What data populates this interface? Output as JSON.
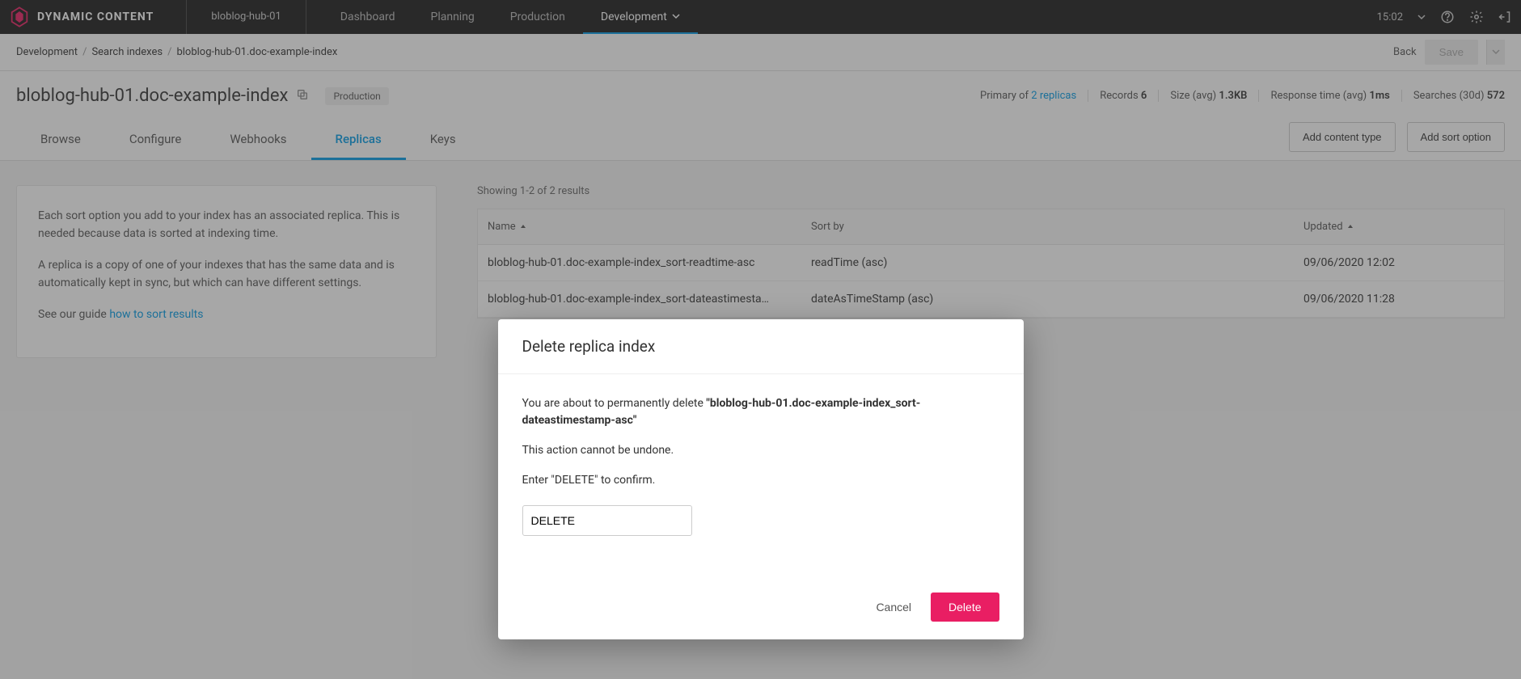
{
  "brand": "DYNAMIC CONTENT",
  "hub": "bloblog-hub-01",
  "top_tabs": {
    "dashboard": "Dashboard",
    "planning": "Planning",
    "production": "Production",
    "development": "Development"
  },
  "time": "15:02",
  "breadcrumbs": {
    "a": "Development",
    "b": "Search indexes",
    "c": "bloblog-hub-01.doc-example-index"
  },
  "back": "Back",
  "save": "Save",
  "page_title": "bloblog-hub-01.doc-example-index",
  "badge": "Production",
  "stats": {
    "primary_label": "Primary of ",
    "primary_link": "2 replicas",
    "records_label": "Records ",
    "records_value": "6",
    "size_label": "Size (avg) ",
    "size_value": "1.3KB",
    "resp_label": "Response time (avg) ",
    "resp_value": "1ms",
    "search_label": "Searches (30d) ",
    "search_value": "572"
  },
  "subtabs": {
    "browse": "Browse",
    "configure": "Configure",
    "webhooks": "Webhooks",
    "replicas": "Replicas",
    "keys": "Keys"
  },
  "actions": {
    "add_content": "Add content type",
    "add_sort": "Add sort option"
  },
  "side": {
    "p1": "Each sort option you add to your index has an associated replica. This is needed because data is sorted at indexing time.",
    "p2": "A replica is a copy of one of your indexes that has the same data and is automatically kept in sync, but which can have different settings.",
    "p3a": "See our guide ",
    "p3b": "how to sort results"
  },
  "results_text": "Showing 1-2 of 2 results",
  "columns": {
    "name": "Name",
    "sortby": "Sort by",
    "updated": "Updated"
  },
  "rows": [
    {
      "name": "bloblog-hub-01.doc-example-index_sort-readtime-asc",
      "sortby": "readTime (asc)",
      "updated": "09/06/2020 12:02"
    },
    {
      "name": "bloblog-hub-01.doc-example-index_sort-dateastimesta…",
      "sortby": "dateAsTimeStamp (asc)",
      "updated": "09/06/2020 11:28"
    }
  ],
  "modal": {
    "title": "Delete replica index",
    "lead": "You are about to permanently delete ",
    "target": "\"bloblog-hub-01.doc-example-index_sort-dateastimestamp-asc\"",
    "warn": "This action cannot be undone.",
    "confirm_label": "Enter \"DELETE\" to confirm.",
    "input_value": "DELETE",
    "cancel": "Cancel",
    "delete": "Delete"
  }
}
